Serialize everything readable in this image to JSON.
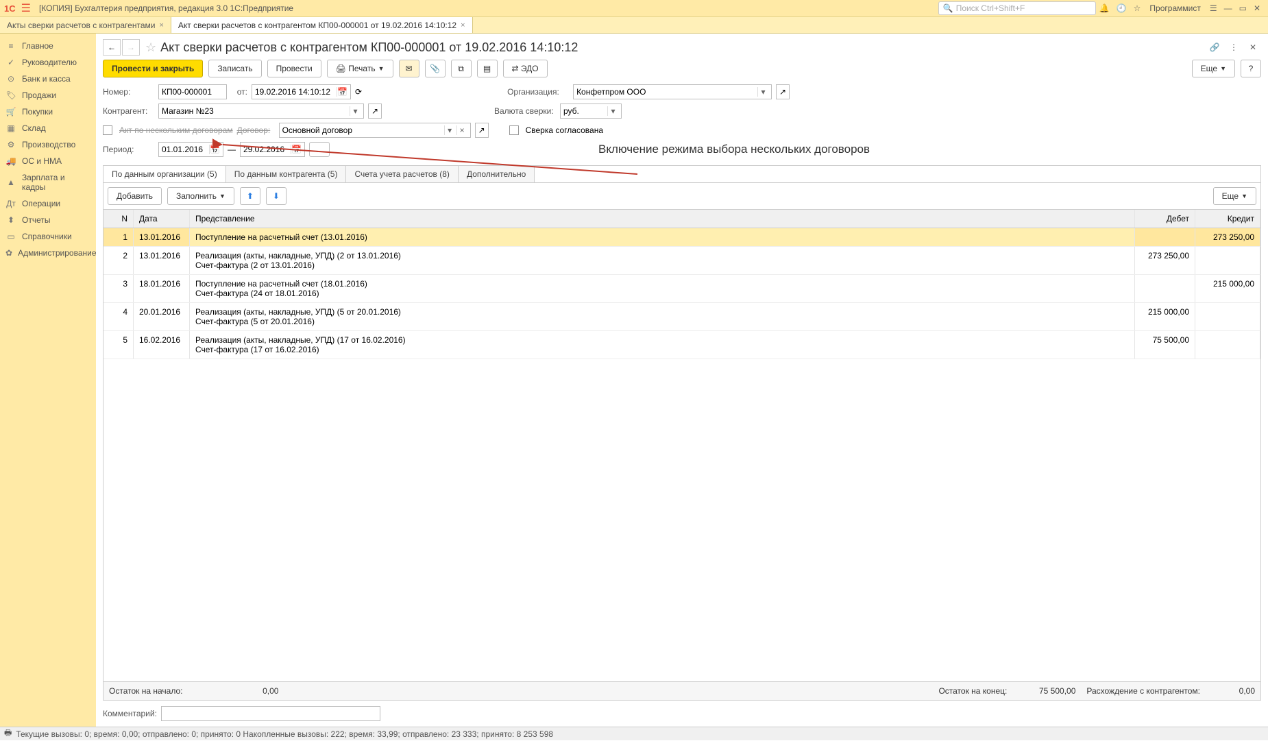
{
  "titlebar": {
    "logo": "1С",
    "app_title": "[КОПИЯ] Бухгалтерия предприятия, редакция 3.0  1С:Предприятие",
    "search_placeholder": "Поиск Ctrl+Shift+F",
    "user": "Программист"
  },
  "tabs": [
    {
      "label": "Акты сверки расчетов с контрагентами"
    },
    {
      "label": "Акт сверки расчетов с контрагентом КП00-000001 от 19.02.2016 14:10:12"
    }
  ],
  "sidebar": [
    {
      "icon": "≡",
      "label": "Главное"
    },
    {
      "icon": "✓",
      "label": "Руководителю"
    },
    {
      "icon": "⊙",
      "label": "Банк и касса"
    },
    {
      "icon": "🏷",
      "label": "Продажи"
    },
    {
      "icon": "🛒",
      "label": "Покупки"
    },
    {
      "icon": "▦",
      "label": "Склад"
    },
    {
      "icon": "⚙",
      "label": "Производство"
    },
    {
      "icon": "🚚",
      "label": "ОС и НМА"
    },
    {
      "icon": "▲",
      "label": "Зарплата и кадры"
    },
    {
      "icon": "Дт",
      "label": "Операции"
    },
    {
      "icon": "⬍",
      "label": "Отчеты"
    },
    {
      "icon": "▭",
      "label": "Справочники"
    },
    {
      "icon": "✿",
      "label": "Администрирование"
    }
  ],
  "doc": {
    "title": "Акт сверки расчетов с контрагентом КП00-000001 от 19.02.2016 14:10:12"
  },
  "toolbar": {
    "post_close": "Провести и закрыть",
    "write": "Записать",
    "post": "Провести",
    "print": "Печать",
    "edo": "ЭДО",
    "more": "Еще"
  },
  "form": {
    "nomer_label": "Номер:",
    "nomer": "КП00-000001",
    "ot_label": "от:",
    "ot": "19.02.2016 14:10:12",
    "org_label": "Организация:",
    "org": "Конфетпром ООО",
    "contragent_label": "Контрагент:",
    "contragent": "Магазин №23",
    "currency_label": "Валюта сверки:",
    "currency": "руб.",
    "multi_label": "Акт по нескольким договорам",
    "dogovor_label": "Договор:",
    "dogovor": "Основной договор",
    "agreed_label": "Сверка согласована",
    "period_label": "Период:",
    "period_from": "01.01.2016",
    "period_dash": "—",
    "period_to": "29.02.2016",
    "period_more": "...",
    "annotation": "Включение режима выбора нескольких договоров"
  },
  "tabs2": [
    "По данным организации (5)",
    "По данным контрагента (5)",
    "Счета учета расчетов (8)",
    "Дополнительно"
  ],
  "subbar": {
    "add": "Добавить",
    "fill": "Заполнить",
    "more": "Еще"
  },
  "columns": {
    "n": "N",
    "date": "Дата",
    "repr": "Представление",
    "debit": "Дебет",
    "credit": "Кредит"
  },
  "rows": [
    {
      "n": "1",
      "date": "13.01.2016",
      "repr": "Поступление на расчетный счет (13.01.2016)",
      "repr2": "",
      "debit": "",
      "credit": "273 250,00"
    },
    {
      "n": "2",
      "date": "13.01.2016",
      "repr": "Реализация (акты, накладные, УПД) (2 от 13.01.2016)",
      "repr2": "Счет-фактура (2 от 13.01.2016)",
      "debit": "273 250,00",
      "credit": ""
    },
    {
      "n": "3",
      "date": "18.01.2016",
      "repr": "Поступление на расчетный счет (18.01.2016)",
      "repr2": "Счет-фактура (24 от 18.01.2016)",
      "debit": "",
      "credit": "215 000,00"
    },
    {
      "n": "4",
      "date": "20.01.2016",
      "repr": "Реализация (акты, накладные, УПД) (5 от 20.01.2016)",
      "repr2": "Счет-фактура (5 от 20.01.2016)",
      "debit": "215 000,00",
      "credit": ""
    },
    {
      "n": "5",
      "date": "16.02.2016",
      "repr": "Реализация (акты, накладные, УПД) (17 от 16.02.2016)",
      "repr2": "Счет-фактура (17 от 16.02.2016)",
      "debit": "75 500,00",
      "credit": ""
    }
  ],
  "footer": {
    "start_label": "Остаток на начало:",
    "start": "0,00",
    "end_label": "Остаток на конец:",
    "end": "75 500,00",
    "diff_label": "Расхождение с контрагентом:",
    "diff": "0,00"
  },
  "comment_label": "Комментарий:",
  "status": "Текущие вызовы: 0; время: 0,00; отправлено: 0; принято: 0   Накопленные вызовы: 222; время: 33,99; отправлено: 23 333; принято: 8 253 598"
}
